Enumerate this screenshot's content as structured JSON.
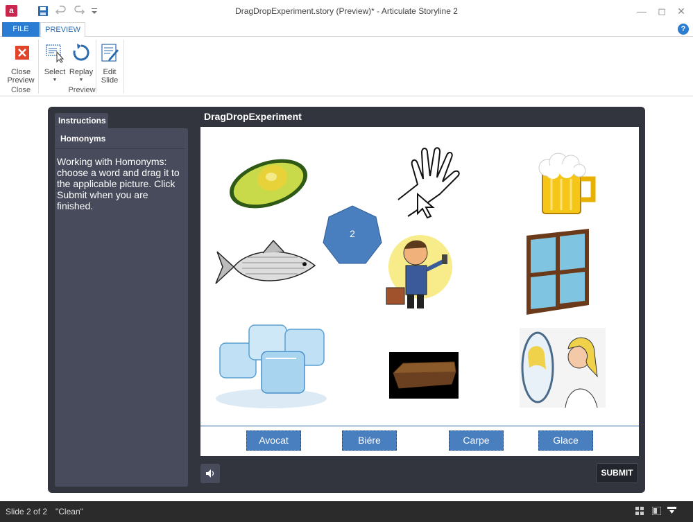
{
  "window": {
    "title": "DragDropExperiment.story (Preview)* -  Articulate Storyline 2",
    "app_logo": "a"
  },
  "tabs": {
    "file": "FILE",
    "preview": "PREVIEW",
    "help": "?"
  },
  "ribbon": {
    "close_preview": "Close\nPreview",
    "close_preview_l1": "Close",
    "close_preview_l2": "Preview",
    "select": "Select",
    "replay": "Replay",
    "edit_slide_l1": "Edit",
    "edit_slide_l2": "Slide",
    "group_close": "Close",
    "group_preview": "Preview"
  },
  "player": {
    "sidebar_tab": "Instructions",
    "sidebar_heading": "Homonyms",
    "sidebar_text": "Working with Homonyms: choose a word and drag it to the applicable picture. Click Submit when you are finished.",
    "slide_title": "DragDropExperiment",
    "polygon_label": "2",
    "words": [
      "Avocat",
      "Biére",
      "Carpe",
      "Glace"
    ],
    "submit": "SUBMIT"
  },
  "status": {
    "slide": "Slide 2 of 2",
    "theme": "\"Clean\""
  },
  "colors": {
    "accent": "#2b7cd3",
    "player_bg": "#32353e",
    "sidebar_bg": "#474b5b",
    "word_bg": "#4a7fbf"
  }
}
